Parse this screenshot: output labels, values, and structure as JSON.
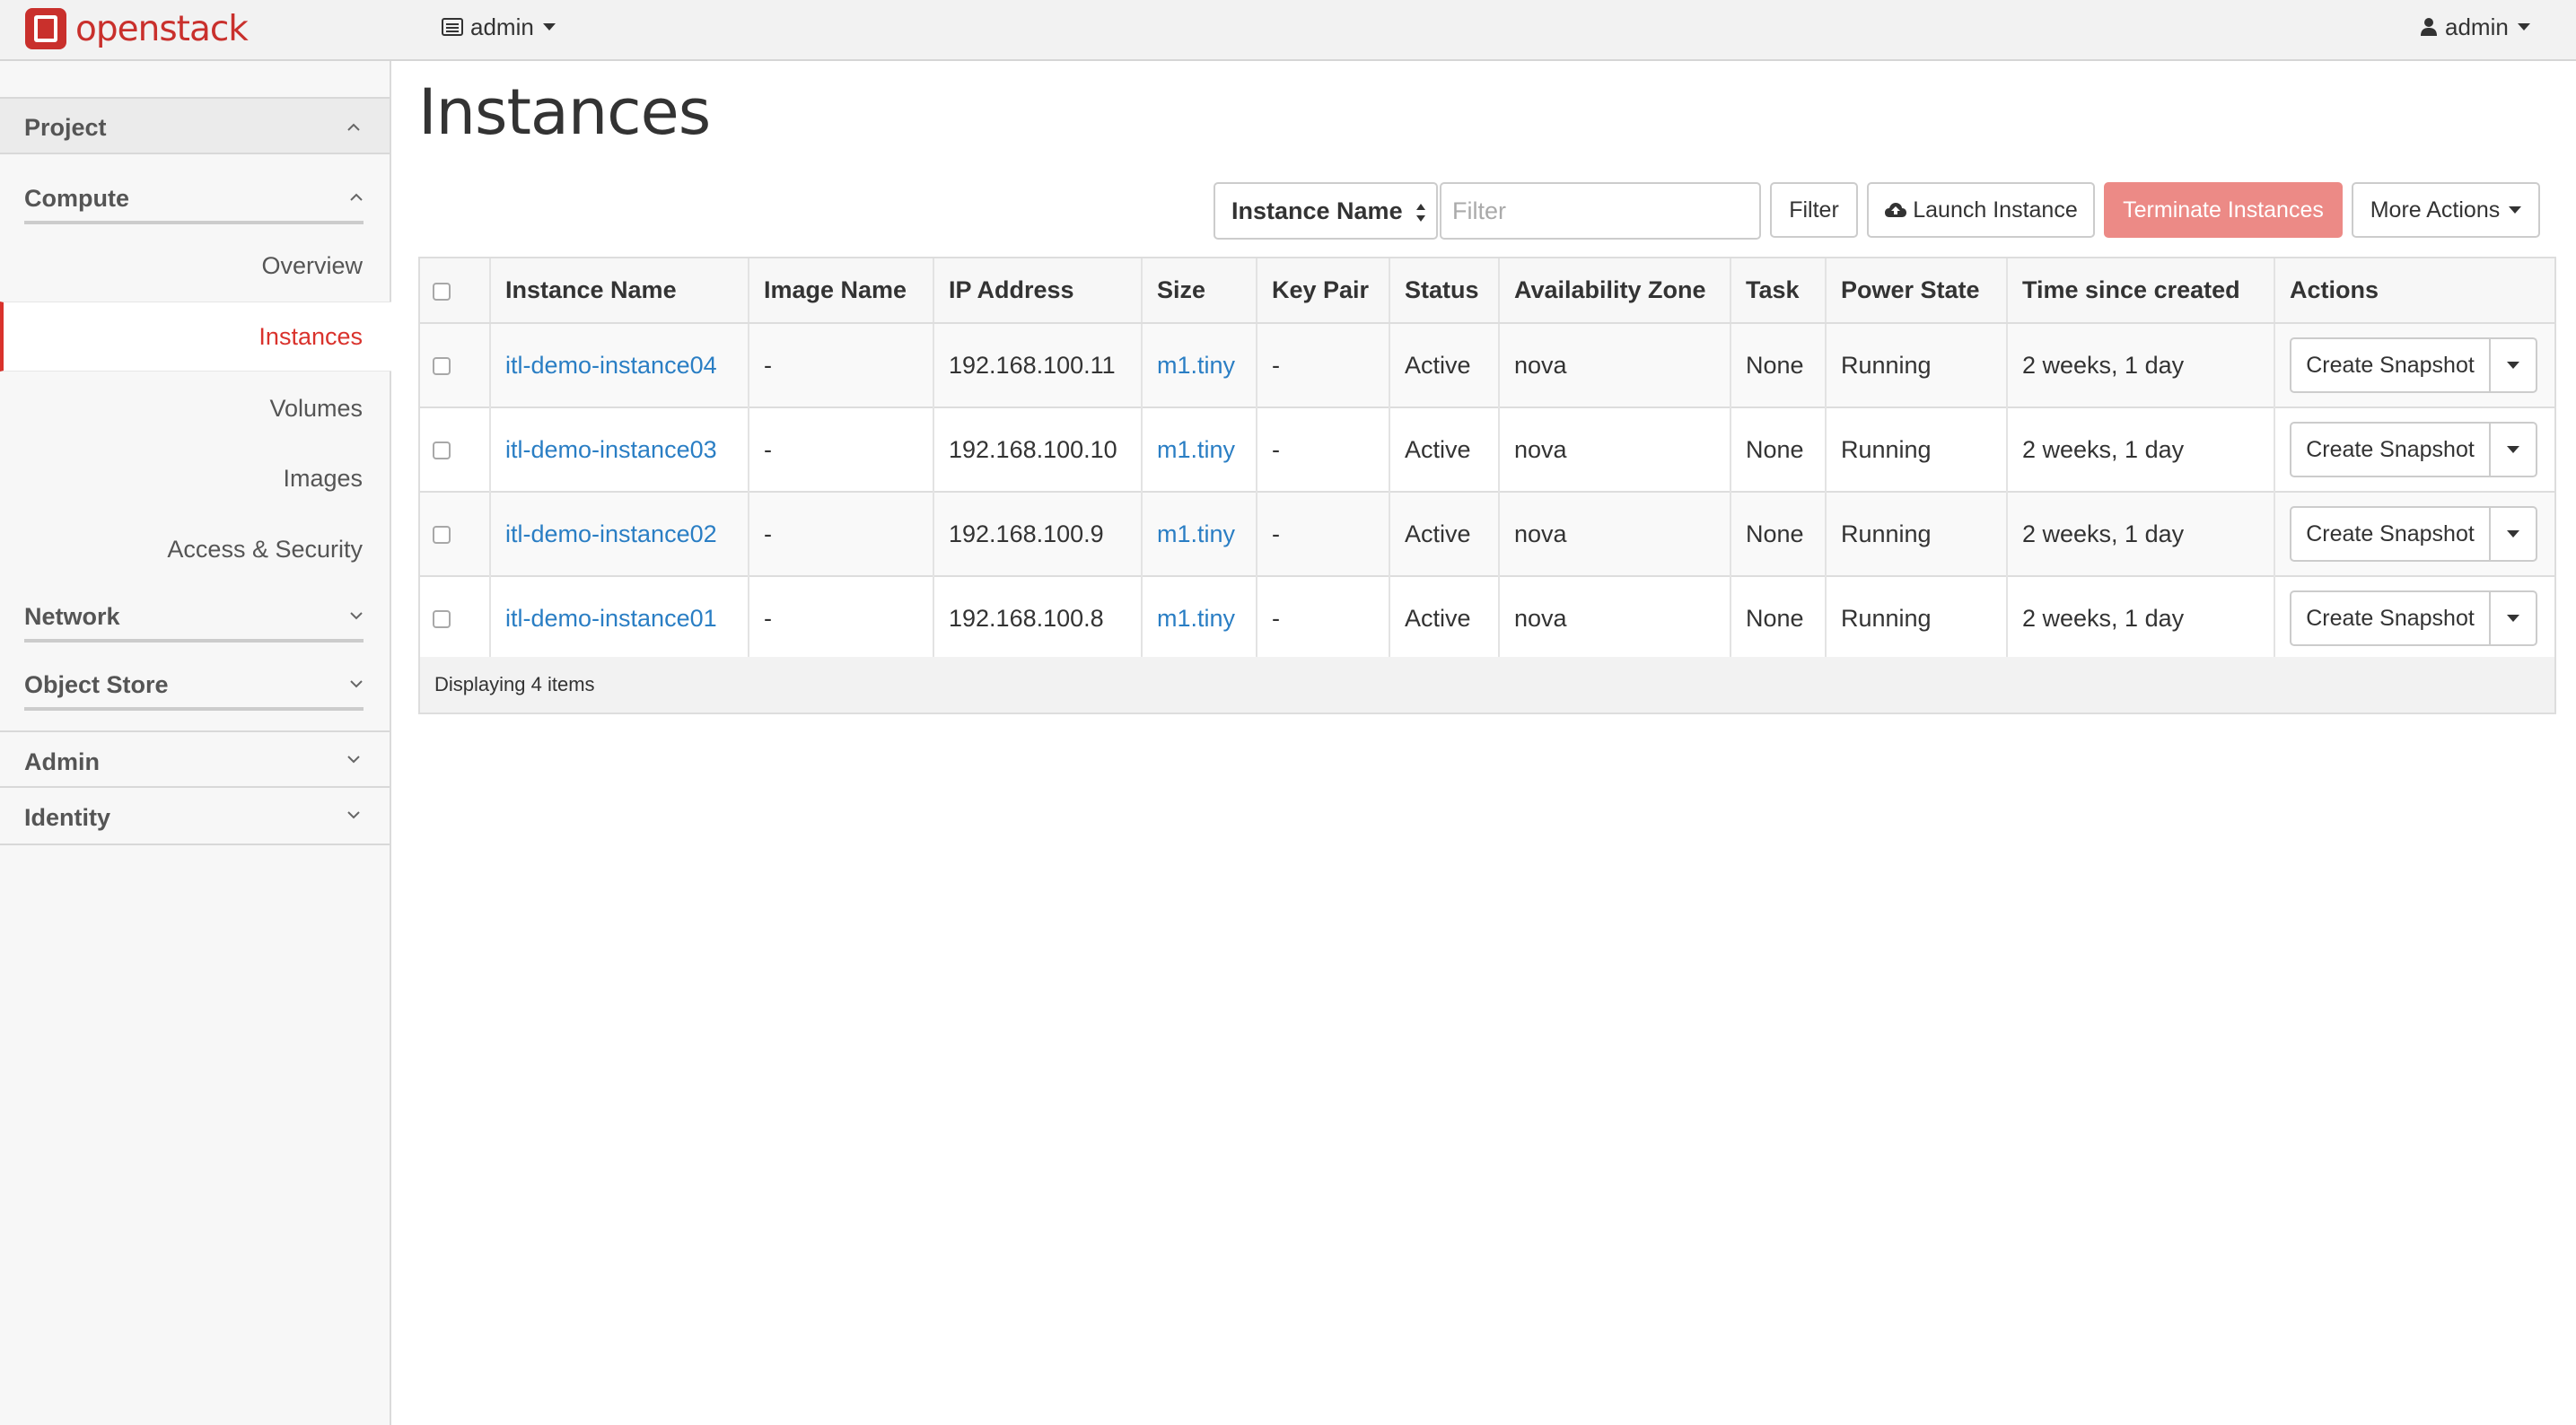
{
  "navbar": {
    "brand": "openstack",
    "project_selector": "admin",
    "user_menu": "admin"
  },
  "sidebar": {
    "project": "Project",
    "compute": "Compute",
    "items": [
      "Overview",
      "Instances",
      "Volumes",
      "Images",
      "Access & Security"
    ],
    "network": "Network",
    "object_store": "Object Store",
    "admin": "Admin",
    "identity": "Identity",
    "active_item": "Instances"
  },
  "page": {
    "title": "Instances"
  },
  "toolbar": {
    "filter_field": "Instance Name",
    "filter_placeholder": "Filter",
    "filter_button": "Filter",
    "launch_button": "Launch Instance",
    "terminate_button": "Terminate Instances",
    "more_actions": "More Actions"
  },
  "table": {
    "columns": [
      "Instance Name",
      "Image Name",
      "IP Address",
      "Size",
      "Key Pair",
      "Status",
      "Availability Zone",
      "Task",
      "Power State",
      "Time since created",
      "Actions"
    ],
    "rows": [
      {
        "name": "itl-demo-instance04",
        "image": "-",
        "ip": "192.168.100.11",
        "size": "m1.tiny",
        "key_pair": "-",
        "status": "Active",
        "zone": "nova",
        "task": "None",
        "power": "Running",
        "age": "2 weeks, 1 day",
        "action": "Create Snapshot"
      },
      {
        "name": "itl-demo-instance03",
        "image": "-",
        "ip": "192.168.100.10",
        "size": "m1.tiny",
        "key_pair": "-",
        "status": "Active",
        "zone": "nova",
        "task": "None",
        "power": "Running",
        "age": "2 weeks, 1 day",
        "action": "Create Snapshot"
      },
      {
        "name": "itl-demo-instance02",
        "image": "-",
        "ip": "192.168.100.9",
        "size": "m1.tiny",
        "key_pair": "-",
        "status": "Active",
        "zone": "nova",
        "task": "None",
        "power": "Running",
        "age": "2 weeks, 1 day",
        "action": "Create Snapshot"
      },
      {
        "name": "itl-demo-instance01",
        "image": "-",
        "ip": "192.168.100.8",
        "size": "m1.tiny",
        "key_pair": "-",
        "status": "Active",
        "zone": "nova",
        "task": "None",
        "power": "Running",
        "age": "2 weeks, 1 day",
        "action": "Create Snapshot"
      }
    ],
    "footer": "Displaying 4 items"
  },
  "colors": {
    "brand": "#c9302c",
    "link": "#2a7ec4",
    "danger": "#ec8a86",
    "active_accent": "#d9322c"
  }
}
